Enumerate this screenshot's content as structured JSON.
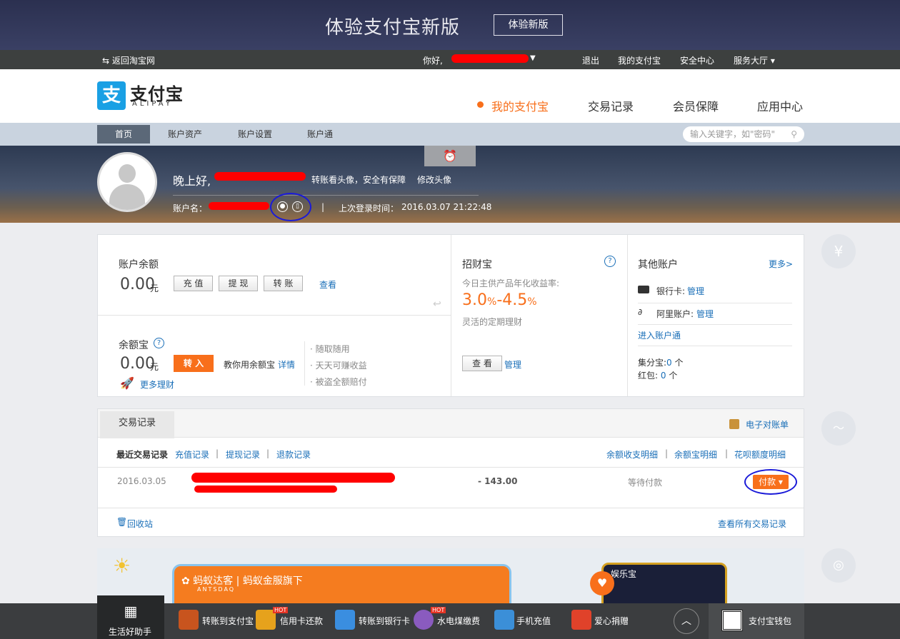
{
  "banner": {
    "title": "体验支付宝新版",
    "button": "体验新版"
  },
  "navbar": {
    "back": "返回淘宝网",
    "greeting": "你好,",
    "logout": "退出",
    "my_alipay": "我的支付宝",
    "security": "安全中心",
    "service": "服务大厅"
  },
  "logo": {
    "cn": "支付宝",
    "en": "ALIPAY",
    "mark": "支"
  },
  "mainnav": [
    "我的支付宝",
    "交易记录",
    "会员保障",
    "应用中心"
  ],
  "subnav": {
    "tabs": [
      "首页",
      "账户资产",
      "账户设置",
      "账户通"
    ],
    "search_placeholder": "输入关键字，如\"密码\""
  },
  "profile": {
    "greeting": "晚上好,",
    "avatar_tip": "转账看头像，安全有保障",
    "edit_avatar": "修改头像",
    "account_label": "账户名：",
    "last_login_label": "上次登录时间：",
    "last_login": "2016.03.07 21:22:48"
  },
  "balance": {
    "title": "账户余额",
    "amount": "0.00",
    "unit": "元",
    "buttons": [
      "充 值",
      "提 现",
      "转 账"
    ],
    "view": "查看"
  },
  "yuebao": {
    "title": "余额宝",
    "amount": "0.00",
    "unit": "元",
    "transfer_in": "转 入",
    "tip": "教你用余额宝",
    "detail": "详情",
    "more": "更多理财",
    "features": [
      "随取随用",
      "天天可赚收益",
      "被盗全额赔付"
    ]
  },
  "zhaocaibao": {
    "title": "招财宝",
    "rate_label": "今日主供产品年化收益率:",
    "rate_low": "3.0",
    "rate_high": "4.5",
    "desc": "灵活的定期理财",
    "view": "查 看",
    "manage": "管理"
  },
  "other": {
    "title": "其他账户",
    "more": "更多>",
    "bank_label": "银行卡:",
    "bank_link": "管理",
    "ali_label": "阿里账户:",
    "ali_link": "管理",
    "enter": "进入账户通",
    "jifen_label": "集分宝:",
    "jifen_value": "0",
    "jifen_unit": "个",
    "hongbao_label": "红包:",
    "hongbao_value": "0",
    "hongbao_unit": "个"
  },
  "transactions": {
    "tab": "交易记录",
    "statement": "电子对账单",
    "recent": "最近交易记录",
    "links_left": [
      "充值记录",
      "提现记录",
      "退款记录"
    ],
    "links_right": [
      "余额收支明细",
      "余额宝明细",
      "花呗额度明细"
    ],
    "rows": [
      {
        "date": "2016.03.05",
        "amount": "- 143.00",
        "status": "等待付款",
        "action": "付款"
      }
    ],
    "recycle": "回收站",
    "view_all": "查看所有交易记录"
  },
  "promo": {
    "brand": "蚂蚁达客",
    "brand_en": "ANTSDAQ",
    "sub": "蚂蚁金服旗下",
    "right_brand": "娱乐宝"
  },
  "bottom": {
    "helper": "生活好助手",
    "items": [
      "转账到支付宝",
      "信用卡还款",
      "转账到银行卡",
      "水电煤缴费",
      "手机充值",
      "爱心捐赠"
    ],
    "hot": "HOT",
    "wallet": "支付宝钱包"
  },
  "colors": {
    "accent": "#f86f1b",
    "brand": "#1aa0e4",
    "link": "#1a6fb8"
  }
}
